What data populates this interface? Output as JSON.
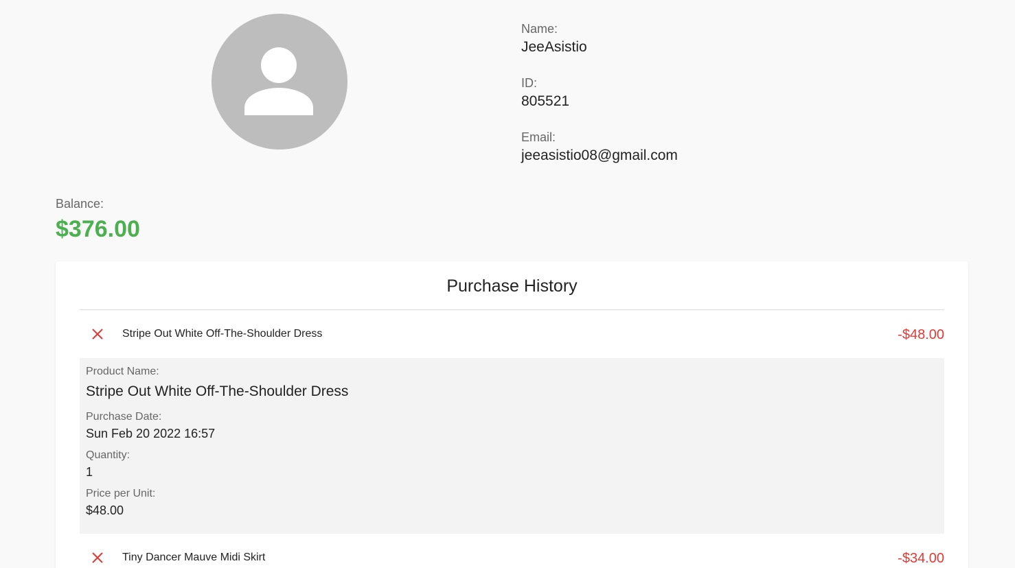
{
  "profile": {
    "name_label": "Name:",
    "name": "JeeAsistio",
    "id_label": "ID:",
    "id": "805521",
    "email_label": "Email:",
    "email": "jeeasistio08@gmail.com"
  },
  "balance": {
    "label": "Balance:",
    "amount": "$376.00",
    "color": "#4caf50"
  },
  "purchase_history": {
    "title": "Purchase History",
    "items": [
      {
        "name": "Stripe Out White Off-The-Shoulder Dress",
        "amount": "-$48.00",
        "icon": "close-icon",
        "details": {
          "product_name_label": "Product Name:",
          "product_name": "Stripe Out White Off-The-Shoulder Dress",
          "purchase_date_label": "Purchase Date:",
          "purchase_date": "Sun Feb 20 2022 16:57",
          "quantity_label": "Quantity:",
          "quantity": "1",
          "price_label": "Price per Unit:",
          "price": "$48.00"
        }
      },
      {
        "name": "Tiny Dancer Mauve Midi Skirt",
        "amount": "-$34.00",
        "icon": "close-icon"
      }
    ]
  },
  "colors": {
    "negative": "#e53935",
    "avatar_bg": "#bdbdbd"
  }
}
